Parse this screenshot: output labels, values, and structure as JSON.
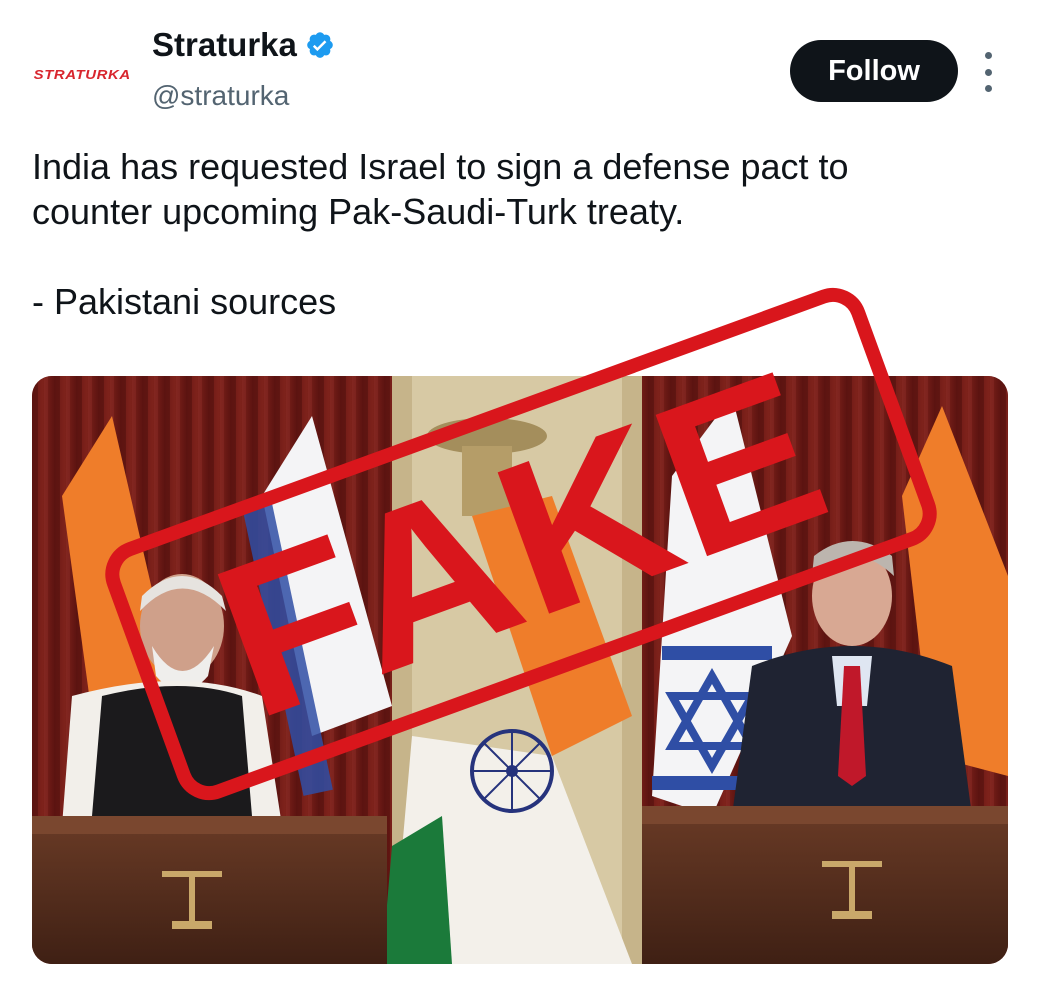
{
  "account": {
    "avatar_text": "STRATURKA",
    "display_name": "Straturka",
    "handle": "@straturka",
    "verified": true
  },
  "actions": {
    "follow_label": "Follow",
    "more_icon": "more-vertical-icon"
  },
  "tweet": {
    "text_line_1": "India has requested Israel to sign a defense pact to",
    "text_line_2": "counter upcoming Pak-Saudi-Turk treaty.",
    "text_line_3": "- Pakistani sources"
  },
  "media": {
    "stamp_text": "FAKE"
  },
  "colors": {
    "text": "#0f1419",
    "secondary": "#536471",
    "verified": "#1d9bf0",
    "stamp": "#d9161c",
    "brand": "#d8262e"
  }
}
